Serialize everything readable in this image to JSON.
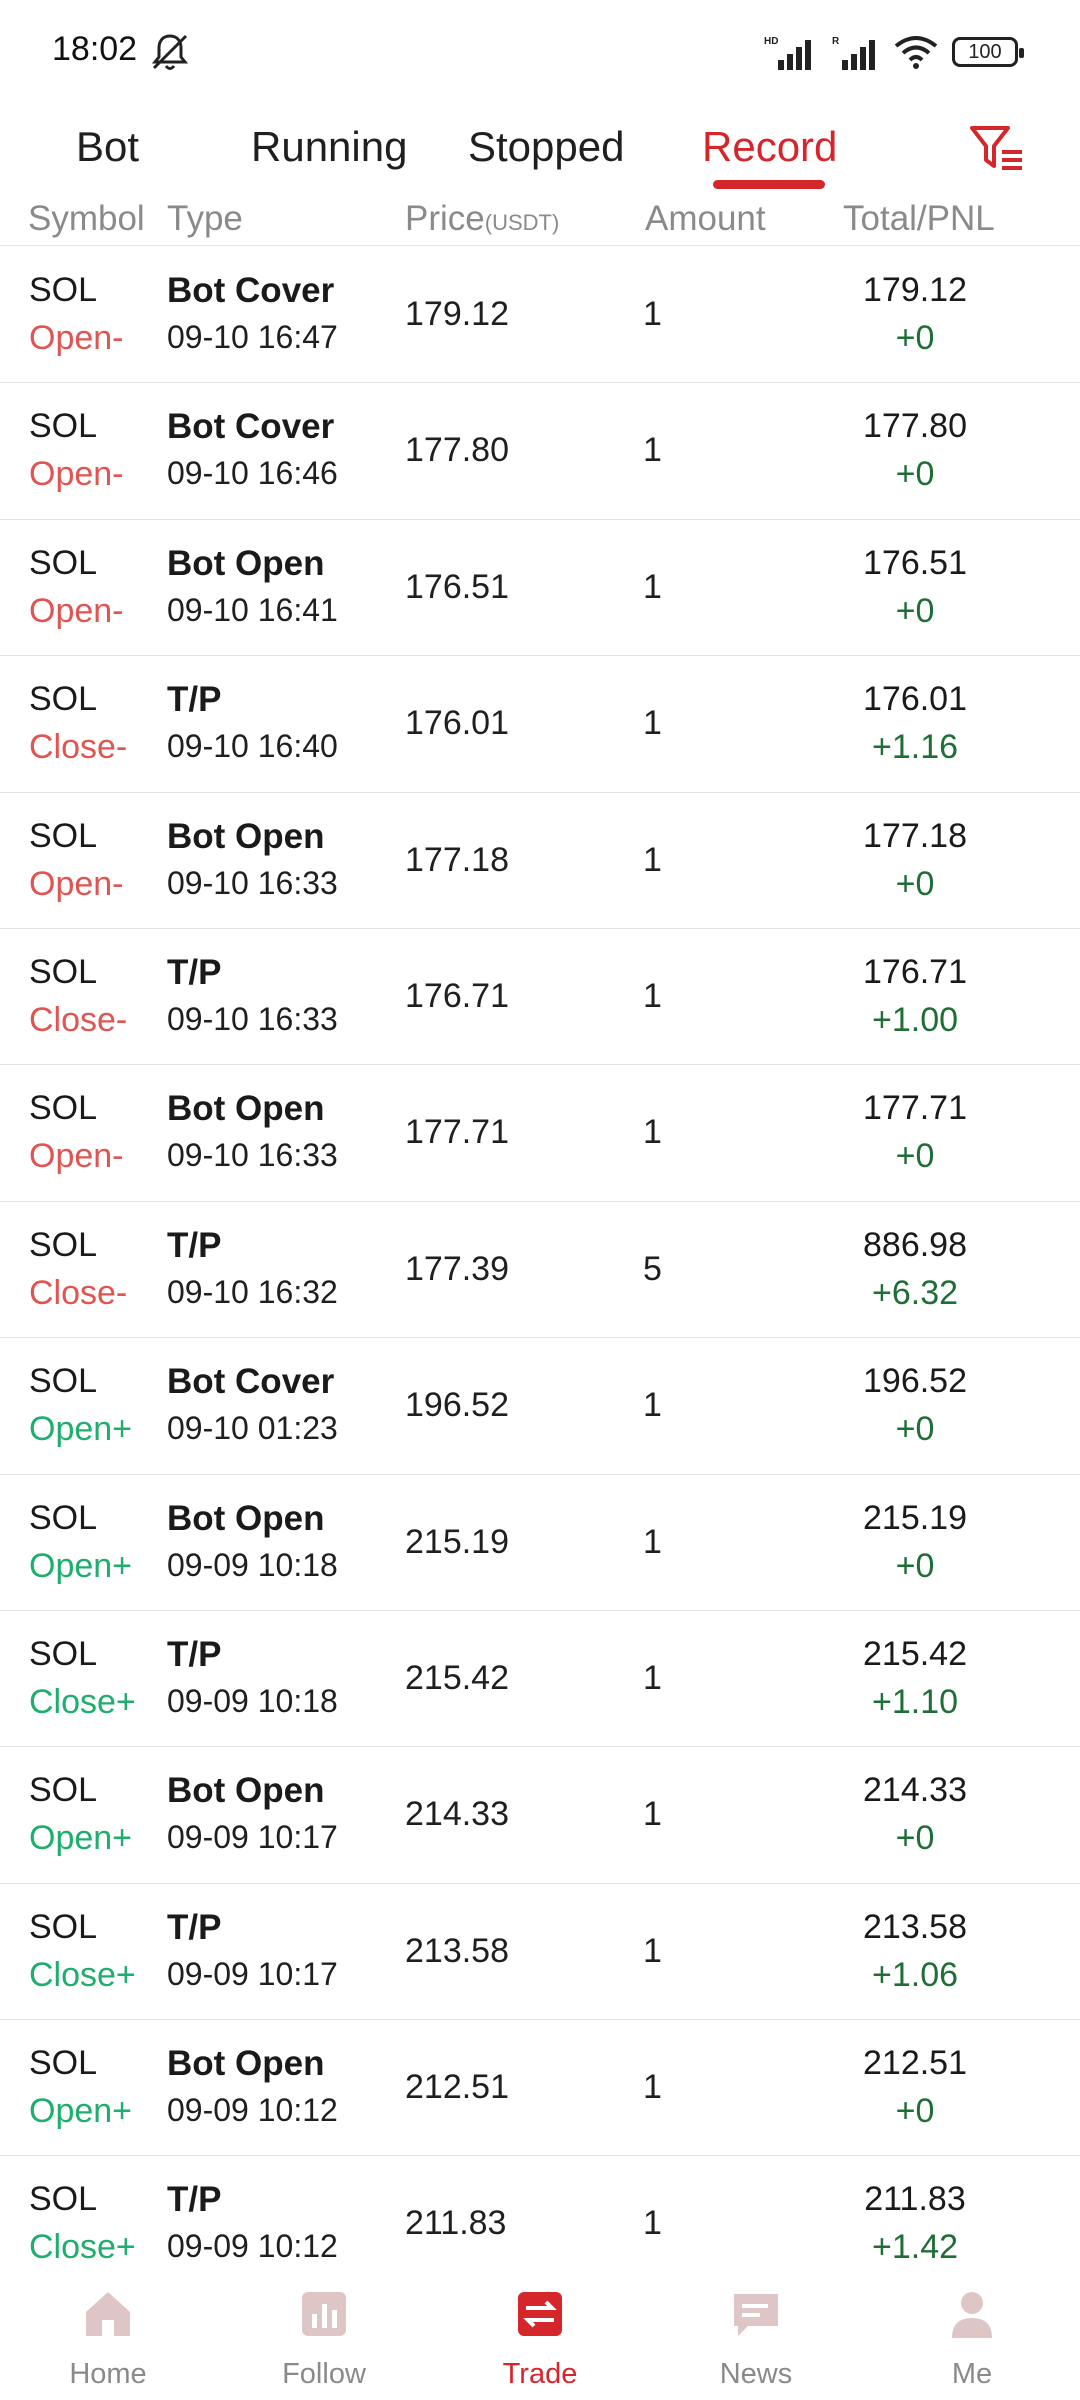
{
  "status_bar": {
    "time": "18:02",
    "battery": "100",
    "icons": [
      "bell-muted-icon",
      "hd-signal-icon",
      "roaming-signal-icon",
      "wifi-icon",
      "battery-icon"
    ]
  },
  "tabs": [
    {
      "label": "Bot",
      "active": false
    },
    {
      "label": "Running",
      "active": false
    },
    {
      "label": "Stopped",
      "active": false
    },
    {
      "label": "Record",
      "active": true
    }
  ],
  "filter_icon": "filter-icon",
  "columns": {
    "symbol": "Symbol",
    "type": "Type",
    "price": "Price",
    "price_unit": "(USDT)",
    "amount": "Amount",
    "total_pnl": "Total/PNL"
  },
  "records": [
    {
      "symbol": "SOL",
      "direction": "Open-",
      "side": "neg",
      "type": "Bot Cover",
      "time": "09-10 16:47",
      "price": "179.12",
      "amount": "1",
      "total": "179.12",
      "pnl": "+0"
    },
    {
      "symbol": "SOL",
      "direction": "Open-",
      "side": "neg",
      "type": "Bot Cover",
      "time": "09-10 16:46",
      "price": "177.80",
      "amount": "1",
      "total": "177.80",
      "pnl": "+0"
    },
    {
      "symbol": "SOL",
      "direction": "Open-",
      "side": "neg",
      "type": "Bot Open",
      "time": "09-10 16:41",
      "price": "176.51",
      "amount": "1",
      "total": "176.51",
      "pnl": "+0"
    },
    {
      "symbol": "SOL",
      "direction": "Close-",
      "side": "neg",
      "type": "T/P",
      "time": "09-10 16:40",
      "price": "176.01",
      "amount": "1",
      "total": "176.01",
      "pnl": "+1.16"
    },
    {
      "symbol": "SOL",
      "direction": "Open-",
      "side": "neg",
      "type": "Bot Open",
      "time": "09-10 16:33",
      "price": "177.18",
      "amount": "1",
      "total": "177.18",
      "pnl": "+0"
    },
    {
      "symbol": "SOL",
      "direction": "Close-",
      "side": "neg",
      "type": "T/P",
      "time": "09-10 16:33",
      "price": "176.71",
      "amount": "1",
      "total": "176.71",
      "pnl": "+1.00"
    },
    {
      "symbol": "SOL",
      "direction": "Open-",
      "side": "neg",
      "type": "Bot Open",
      "time": "09-10 16:33",
      "price": "177.71",
      "amount": "1",
      "total": "177.71",
      "pnl": "+0"
    },
    {
      "symbol": "SOL",
      "direction": "Close-",
      "side": "neg",
      "type": "T/P",
      "time": "09-10 16:32",
      "price": "177.39",
      "amount": "5",
      "total": "886.98",
      "pnl": "+6.32"
    },
    {
      "symbol": "SOL",
      "direction": "Open+",
      "side": "pos",
      "type": "Bot Cover",
      "time": "09-10 01:23",
      "price": "196.52",
      "amount": "1",
      "total": "196.52",
      "pnl": "+0"
    },
    {
      "symbol": "SOL",
      "direction": "Open+",
      "side": "pos",
      "type": "Bot Open",
      "time": "09-09 10:18",
      "price": "215.19",
      "amount": "1",
      "total": "215.19",
      "pnl": "+0"
    },
    {
      "symbol": "SOL",
      "direction": "Close+",
      "side": "pos",
      "type": "T/P",
      "time": "09-09 10:18",
      "price": "215.42",
      "amount": "1",
      "total": "215.42",
      "pnl": "+1.10"
    },
    {
      "symbol": "SOL",
      "direction": "Open+",
      "side": "pos",
      "type": "Bot Open",
      "time": "09-09 10:17",
      "price": "214.33",
      "amount": "1",
      "total": "214.33",
      "pnl": "+0"
    },
    {
      "symbol": "SOL",
      "direction": "Close+",
      "side": "pos",
      "type": "T/P",
      "time": "09-09 10:17",
      "price": "213.58",
      "amount": "1",
      "total": "213.58",
      "pnl": "+1.06"
    },
    {
      "symbol": "SOL",
      "direction": "Open+",
      "side": "pos",
      "type": "Bot Open",
      "time": "09-09 10:12",
      "price": "212.51",
      "amount": "1",
      "total": "212.51",
      "pnl": "+0"
    },
    {
      "symbol": "SOL",
      "direction": "Close+",
      "side": "pos",
      "type": "T/P",
      "time": "09-09 10:12",
      "price": "211.83",
      "amount": "1",
      "total": "211.83",
      "pnl": "+1.42"
    }
  ],
  "bottom_nav": [
    {
      "label": "Home",
      "icon": "home-icon",
      "active": false
    },
    {
      "label": "Follow",
      "icon": "chart-icon",
      "active": false
    },
    {
      "label": "Trade",
      "icon": "trade-icon",
      "active": true
    },
    {
      "label": "News",
      "icon": "news-icon",
      "active": false
    },
    {
      "label": "Me",
      "icon": "user-icon",
      "active": false
    }
  ],
  "colors": {
    "accent": "#d5262b",
    "open_close_minus": "#e05452",
    "open_close_plus": "#1fae6e",
    "pnl": "#1e6e36",
    "nav_inactive": "#d9c3c3"
  }
}
